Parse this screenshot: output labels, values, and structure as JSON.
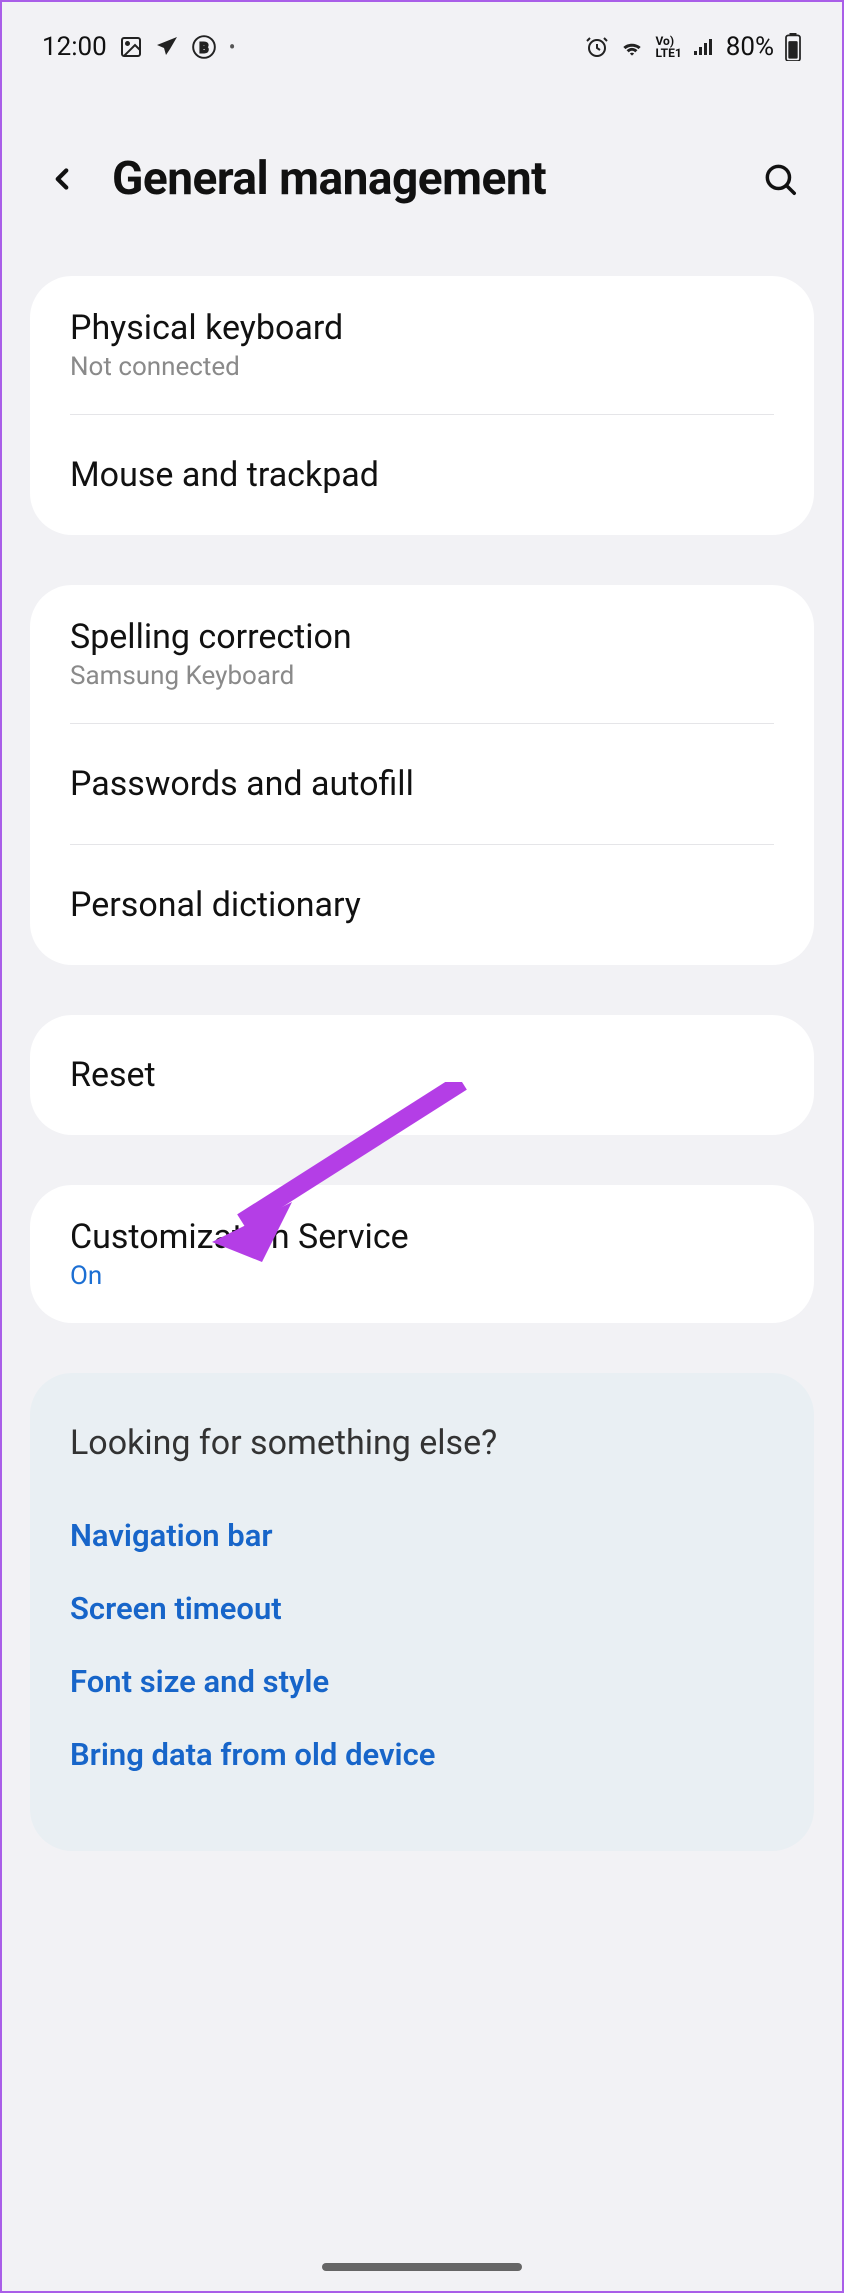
{
  "status_bar": {
    "time": "12:00",
    "battery": "80%"
  },
  "header": {
    "title": "General management"
  },
  "groups": [
    {
      "items": [
        {
          "title": "Physical keyboard",
          "subtitle": "Not connected"
        },
        {
          "title": "Mouse and trackpad"
        }
      ]
    },
    {
      "items": [
        {
          "title": "Spelling correction",
          "subtitle": "Samsung Keyboard"
        },
        {
          "title": "Passwords and autofill"
        },
        {
          "title": "Personal dictionary"
        }
      ]
    },
    {
      "items": [
        {
          "title": "Reset"
        }
      ]
    },
    {
      "items": [
        {
          "title": "Customization Service",
          "subtitle": "On",
          "subtitle_blue": true
        }
      ]
    }
  ],
  "suggestions": {
    "title": "Looking for something else?",
    "links": [
      "Navigation bar",
      "Screen timeout",
      "Font size and style",
      "Bring data from old device"
    ]
  }
}
